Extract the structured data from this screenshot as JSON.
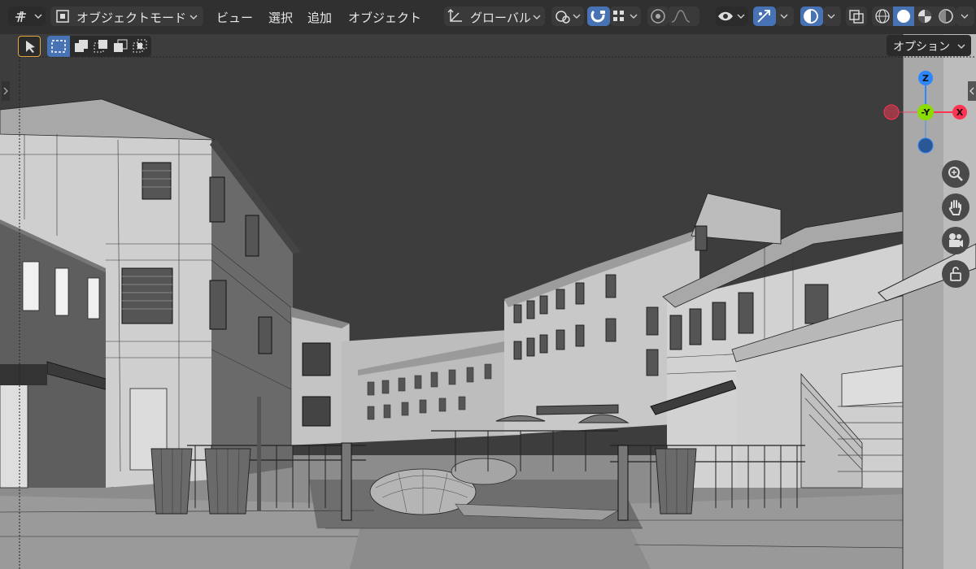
{
  "header": {
    "mode_label": "オブジェクトモード",
    "menus": [
      "ビュー",
      "選択",
      "追加",
      "オブジェクト"
    ],
    "transform_orientation": "グローバル",
    "options_label": "オプション"
  },
  "gizmo": {
    "z_label": "Z",
    "y_label": "-Y",
    "x_label": "X"
  },
  "colors": {
    "header_bg": "#303030",
    "viewport_bg": "#3d3d3d",
    "accent_blue": "#4772b3",
    "axis_x": "#ff3352",
    "axis_y": "#8bdc00",
    "axis_z": "#2b86ff"
  },
  "icons": [
    "editor-type-icon",
    "object-mode-icon",
    "transform-orientation-icon",
    "pivot-icon",
    "snap-icon",
    "snap-increment-icon",
    "proportional-edit-icon",
    "falloff-icon",
    "visibility-icon",
    "gizmo-icon",
    "overlay-icon",
    "xray-icon",
    "wireframe-shading-icon",
    "solid-shading-icon",
    "material-shading-icon",
    "rendered-shading-icon",
    "select-tool-icon",
    "select-box-new-icon",
    "select-box-extend-icon",
    "select-box-subtract-icon",
    "select-box-invert-icon",
    "select-box-intersect-icon",
    "zoom-icon",
    "pan-hand-icon",
    "camera-icon",
    "lock-icon"
  ]
}
